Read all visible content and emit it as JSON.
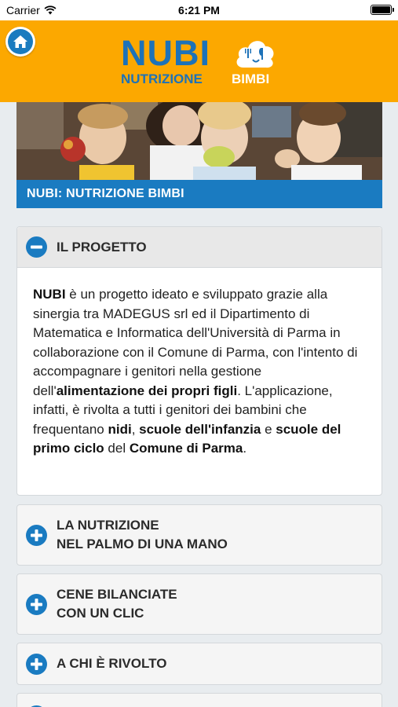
{
  "status_bar": {
    "carrier": "Carrier",
    "time": "6:21 PM"
  },
  "header": {
    "logo_title": "NUBI",
    "logo_sub_left": "NUTRIZIONE",
    "logo_sub_right": "BIMBI",
    "brand_color": "#fca800"
  },
  "hero": {
    "banner_title": "NUBI: NUTRIZIONE BIMBI"
  },
  "sections": [
    {
      "title": "IL PROGETTO",
      "expanded": true,
      "body": [
        {
          "text": "NUBI",
          "bold": true
        },
        {
          "text": " è un progetto ideato e sviluppato grazie alla sinergia tra MADEGUS srl ed il Dipartimento di Matematica e Informatica dell'Università di Parma in collaborazione con il Comune di Parma, con l'intento di accompagnare i genitori nella gestione dell'",
          "bold": false
        },
        {
          "text": "alimentazione dei propri figli",
          "bold": true
        },
        {
          "text": ". L'applicazione, infatti, è rivolta a tutti i genitori dei bambini che frequentano ",
          "bold": false
        },
        {
          "text": "nidi",
          "bold": true
        },
        {
          "text": ", ",
          "bold": false
        },
        {
          "text": "scuole dell'infanzia",
          "bold": true
        },
        {
          "text": " e ",
          "bold": false
        },
        {
          "text": "scuole del primo ciclo",
          "bold": true
        },
        {
          "text": " del ",
          "bold": false
        },
        {
          "text": "Comune di Parma",
          "bold": true
        },
        {
          "text": ".",
          "bold": false
        }
      ]
    },
    {
      "title": "LA NUTRIZIONE\nNEL PALMO DI UNA MANO",
      "expanded": false
    },
    {
      "title": "CENE BILANCIATE\nCON UN CLIC",
      "expanded": false
    },
    {
      "title": "A CHI È RIVOLTO",
      "expanded": false
    }
  ],
  "icons": {
    "home": "home-icon",
    "collapse": "minus-circle-icon",
    "expand": "plus-circle-icon",
    "wifi": "wifi-icon",
    "battery": "battery-icon"
  },
  "colors": {
    "accent_blue": "#1a7bc1",
    "panel_border": "#d4d8db"
  }
}
